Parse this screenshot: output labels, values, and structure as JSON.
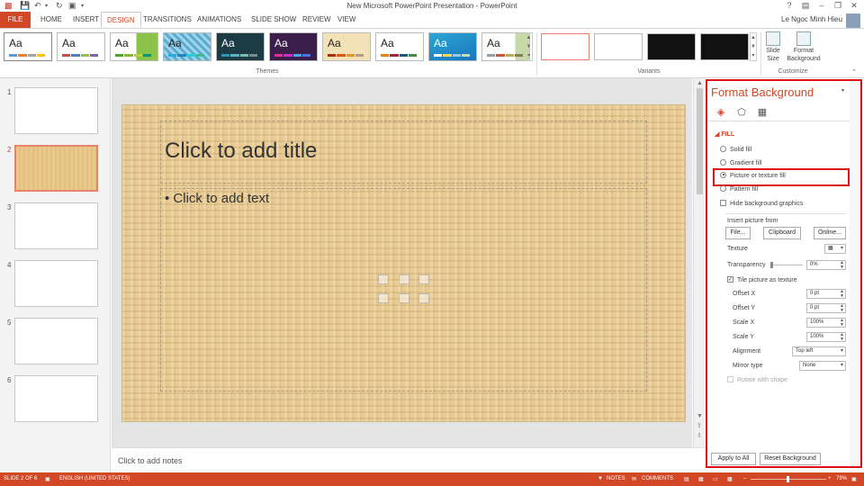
{
  "window": {
    "title": "New Microsoft PowerPoint Presentation - PowerPoint"
  },
  "tabs": [
    "FILE",
    "HOME",
    "INSERT",
    "DESIGN",
    "TRANSITIONS",
    "ANIMATIONS",
    "SLIDE SHOW",
    "REVIEW",
    "VIEW"
  ],
  "active_tab": "DESIGN",
  "user": {
    "name": "Le Ngoc Minh Hieu"
  },
  "ribbon": {
    "themes_label": "Themes",
    "variants_label": "Variants",
    "customize_label": "Customize",
    "theme_sample": "Aa",
    "slide_size": "Slide Size",
    "format_background": "Format Background"
  },
  "slides": {
    "numbers": [
      "1",
      "2",
      "3",
      "4",
      "5",
      "6"
    ],
    "selected_index": 1
  },
  "slide": {
    "title_placeholder": "Click to add title",
    "body_placeholder": "• Click to add text"
  },
  "notes": {
    "placeholder": "Click to add notes"
  },
  "pane": {
    "title": "Format Background",
    "section": "FILL",
    "fill_options": [
      "Solid fill",
      "Gradient fill",
      "Picture or texture fill",
      "Pattern fill"
    ],
    "selected_fill": "Picture or texture fill",
    "hide_background_graphics": "Hide background graphics",
    "insert_picture_from": "Insert picture from",
    "file_button": "File...",
    "clipboard_button": "Clipboard",
    "online_button": "Online...",
    "texture_label": "Texture",
    "transparency_label": "Transparency",
    "transparency_value": "0%",
    "tile_label": "Tile picture as texture",
    "offset_x_label": "Offset X",
    "offset_x_value": "0 pt",
    "offset_y_label": "Offset Y",
    "offset_y_value": "0 pt",
    "scale_x_label": "Scale X",
    "scale_x_value": "100%",
    "scale_y_label": "Scale Y",
    "scale_y_value": "100%",
    "alignment_label": "Alignment",
    "alignment_value": "Top left",
    "mirror_label": "Mirror type",
    "mirror_value": "None",
    "rotate_label": "Rotate with shape",
    "apply_all": "Apply to All",
    "reset_bg": "Reset Background"
  },
  "status": {
    "slide_of": "SLIDE 2 OF 6",
    "language": "ENGLISH (UNITED STATES)",
    "notes": "NOTES",
    "comments": "COMMENTS",
    "zoom": "79%"
  }
}
